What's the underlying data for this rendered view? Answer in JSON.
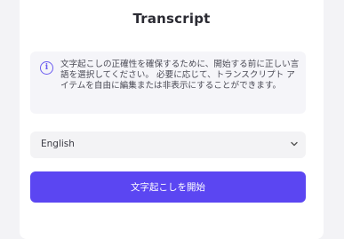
{
  "panel": {
    "title": "Transcript",
    "notice": {
      "icon": "info-icon",
      "text": "文字起こしの正確性を確保するために、開始する前に正しい言語を選択してください。 必要に応じて、トランスクリプト アイテムを自由に編集または非表示にすることができます。"
    },
    "language_select": {
      "value": "English",
      "icon": "chevron-down-icon"
    },
    "start_button": {
      "label": "文字起こしを開始"
    }
  },
  "colors": {
    "accent": "#5b46f2",
    "background": "#f3f3f6",
    "panel": "#ffffff",
    "notice_bg": "#f5f5f9"
  }
}
